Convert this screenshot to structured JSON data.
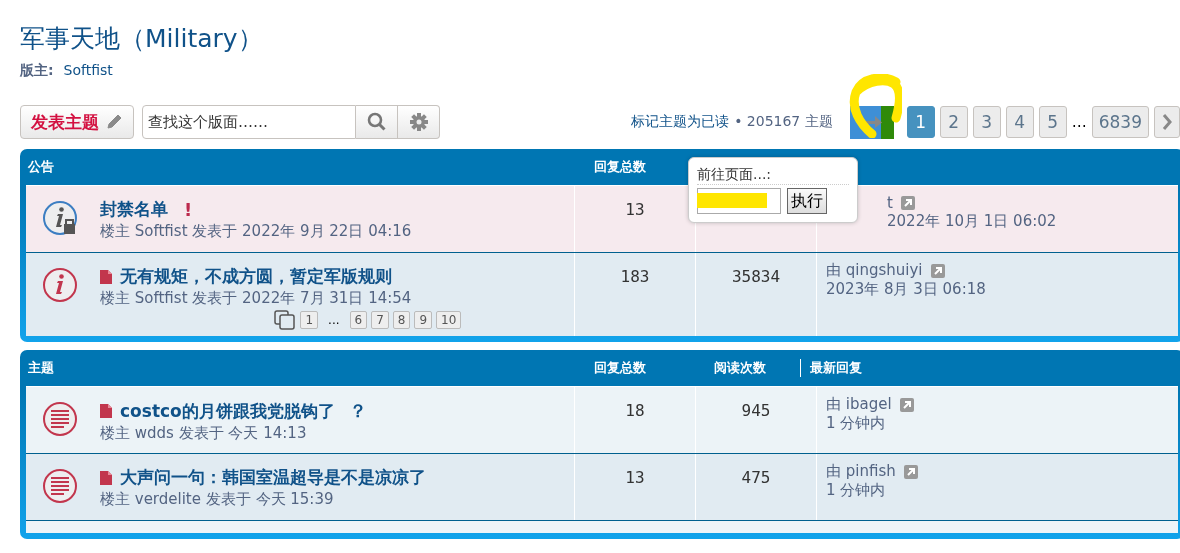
{
  "forum": {
    "title": "军事天地（Military）",
    "moderator_label": "版主:",
    "moderator": "Softfist"
  },
  "actions": {
    "new_topic": "发表主题",
    "search": {
      "placeholder": "查找这个版面……"
    },
    "mark_read": "标记主题为已读",
    "topic_count": "• 205167 主题",
    "pages": [
      {
        "label": "1",
        "selected": true
      },
      {
        "label": "2",
        "selected": false
      },
      {
        "label": "3",
        "selected": false
      },
      {
        "label": "4",
        "selected": false
      },
      {
        "label": "5",
        "selected": false
      },
      {
        "label": "…",
        "kind": "gap"
      },
      {
        "label": "6839",
        "selected": false
      }
    ]
  },
  "jump_popup": {
    "label": "前往页面...:",
    "button": "执行"
  },
  "sections": [
    {
      "heading": "公告",
      "columns": [
        "回复总数"
      ],
      "rows": [
        {
          "kind": "locked",
          "title": "封禁名单",
          "badge": "!",
          "meta": "楼主 Softfist 发表于 2022年 9月 22日 04:16",
          "replies": "13",
          "last_by": "t",
          "last_time": "2022年 10月 1日 06:02",
          "covered": true,
          "has_doc": false
        },
        {
          "kind": "info",
          "title": "无有规矩，不成方圆，暂定军版规则",
          "meta": "楼主 Softfist 发表于 2022年 7月 31日 14:54",
          "replies": "183",
          "views": "35834",
          "last_by": "由 qingshuiyi",
          "last_time": "2023年 8月 3日 06:18",
          "covered": false,
          "has_doc": true,
          "pages": [
            "1",
            "...",
            "6",
            "7",
            "8",
            "9",
            "10"
          ]
        }
      ]
    },
    {
      "heading": "主题",
      "columns": [
        "回复总数",
        "阅读次数",
        "最新回复"
      ],
      "rows": [
        {
          "kind": "topic",
          "title": "costco的月饼跟我党脱钩了",
          "badge": "？",
          "meta": "楼主 wdds 发表于 今天 14:13",
          "replies": "18",
          "views": "945",
          "last_by": "由 ibagel",
          "last_time": "1 分钟内",
          "covered": false,
          "has_doc": true
        },
        {
          "kind": "topic",
          "title": "大声问一句：韩国室温超导是不是凉凉了",
          "meta": "楼主 verdelite 发表于 今天 15:39",
          "replies": "13",
          "views": "475",
          "last_by": "由 pinfish",
          "last_time": "1 分钟内",
          "covered": false,
          "has_doc": true
        },
        {
          "kind": "cut"
        }
      ]
    }
  ]
}
